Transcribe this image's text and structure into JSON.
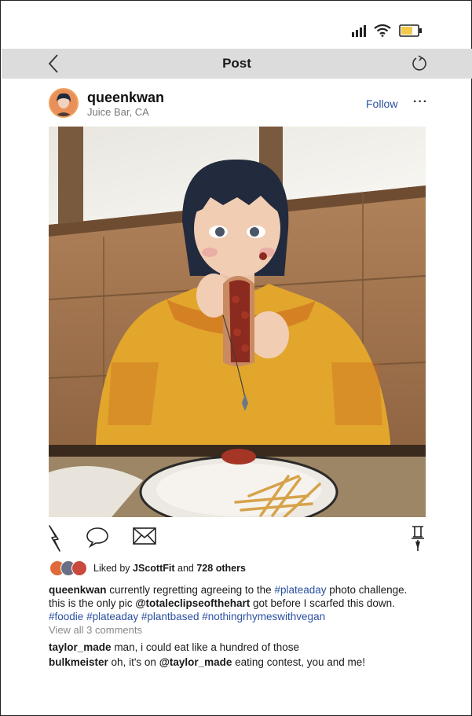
{
  "header": {
    "title": "Post"
  },
  "profile": {
    "username": "queenkwan",
    "location": "Juice Bar, CA",
    "follow_label": "Follow",
    "more_label": "···"
  },
  "likes": {
    "prefix": "Liked by",
    "user": "JScottFit",
    "and": "and",
    "others": "728 others"
  },
  "caption": {
    "username": "queenkwan",
    "text1": "currently regretting agreeing to the",
    "tag1": "#plateaday",
    "text2": "photo challenge.",
    "text3": "this is the only pic",
    "mention": "@totaleclipseofthehart",
    "text4": "got before I scarfed this down.",
    "tag2": "#foodie",
    "tag3": "#plateaday",
    "tag4": "#plantbased",
    "tag5": "#nothingrhymeswithvegan"
  },
  "view_all": "View all 3 comments",
  "comments": [
    {
      "user": "taylor_made",
      "text": "man, i could eat like a hundred of those"
    },
    {
      "user": "bulkmeister",
      "text": "oh, it's on",
      "mention": "@taylor_made",
      "text2": "eating contest, you and me!"
    }
  ],
  "colors": {
    "header_bg": "#dcdcdc",
    "link": "#2b4fa0",
    "battery": "#f3c94a"
  }
}
